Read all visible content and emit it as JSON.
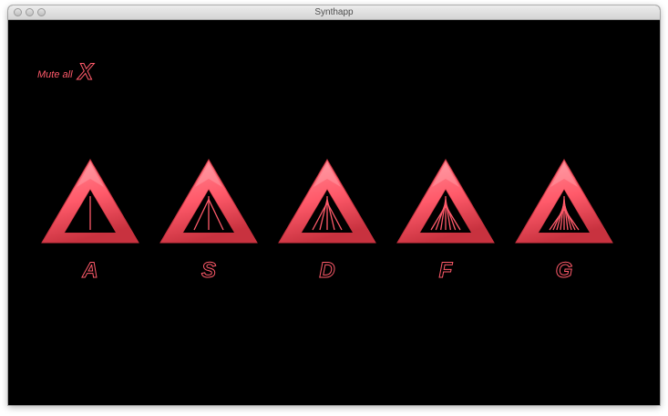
{
  "window": {
    "title": "Synthapp"
  },
  "mute": {
    "label": "Mute all",
    "key": "X"
  },
  "pads": [
    {
      "key": "A",
      "lines": 1
    },
    {
      "key": "S",
      "lines": 3
    },
    {
      "key": "D",
      "lines": 5
    },
    {
      "key": "F",
      "lines": 7
    },
    {
      "key": "G",
      "lines": 9
    }
  ],
  "colors": {
    "accent": "#ff5a6a",
    "accent_light": "#ff8c96",
    "accent_dark": "#c8323f",
    "background": "#000000"
  }
}
